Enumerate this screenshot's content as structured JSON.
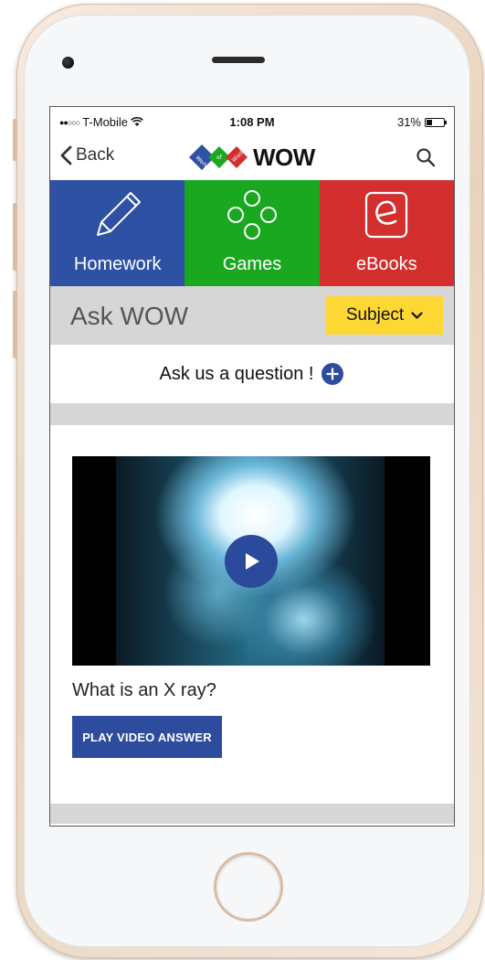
{
  "status_bar": {
    "carrier": "T-Mobile",
    "signal_dots": "●●○○○",
    "time": "1:08 PM",
    "battery_percent": "31%",
    "battery_level": 0.31
  },
  "nav": {
    "back_label": "Back",
    "logo_text": "WOW",
    "logo_badge_words": [
      "World",
      "of",
      "Wisdom"
    ]
  },
  "categories": [
    {
      "label": "Homework",
      "icon": "pencil-icon",
      "color": "#2f51a3"
    },
    {
      "label": "Games",
      "icon": "games-dots-icon",
      "color": "#19a81f"
    },
    {
      "label": "eBooks",
      "icon": "ebook-icon",
      "color": "#d32f2f"
    }
  ],
  "section": {
    "title": "Ask WOW",
    "subject_label": "Subject"
  },
  "ask": {
    "prompt": "Ask us a question !"
  },
  "card": {
    "question": "What is an X ray?",
    "play_button_label": "PLAY VIDEO ANSWER"
  },
  "colors": {
    "accent_blue": "#2e4c9e",
    "subject_yellow": "#fdd835",
    "header_gray": "#d6d6d6"
  }
}
